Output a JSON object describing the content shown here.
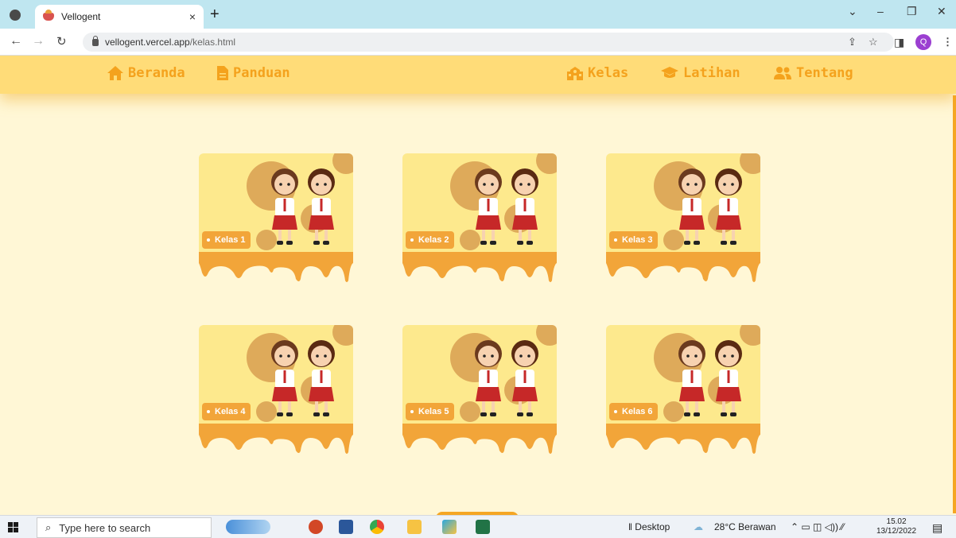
{
  "browser": {
    "tab_title": "Vellogent",
    "tab_close": "×",
    "new_tab": "+",
    "url_host": "vellogent.vercel.app",
    "url_path": "/kelas.html",
    "profile_initial": "Q",
    "window_controls": [
      "⌄",
      "–",
      "❐",
      "✕"
    ]
  },
  "navbar": {
    "left": [
      {
        "label": "Beranda",
        "icon": "home-icon"
      },
      {
        "label": "Panduan",
        "icon": "document-icon"
      }
    ],
    "right": [
      {
        "label": "Kelas",
        "icon": "school-icon"
      },
      {
        "label": "Latihan",
        "icon": "graduation-cap-icon"
      },
      {
        "label": "Tentang",
        "icon": "users-icon"
      }
    ]
  },
  "classes": [
    {
      "label": "Kelas 1"
    },
    {
      "label": "Kelas 2"
    },
    {
      "label": "Kelas 3"
    },
    {
      "label": "Kelas 4"
    },
    {
      "label": "Kelas 5"
    },
    {
      "label": "Kelas 6"
    }
  ],
  "taskbar": {
    "search_placeholder": "Type here to search",
    "desktop_label": "Desktop",
    "weather": "28°C  Berawan",
    "time": "15.02",
    "date": "13/12/2022"
  },
  "colors": {
    "navbar": "#ffdc78",
    "accent": "#f4a21d",
    "page_bg": "#fff7d6",
    "card_bg": "#fde98d"
  }
}
